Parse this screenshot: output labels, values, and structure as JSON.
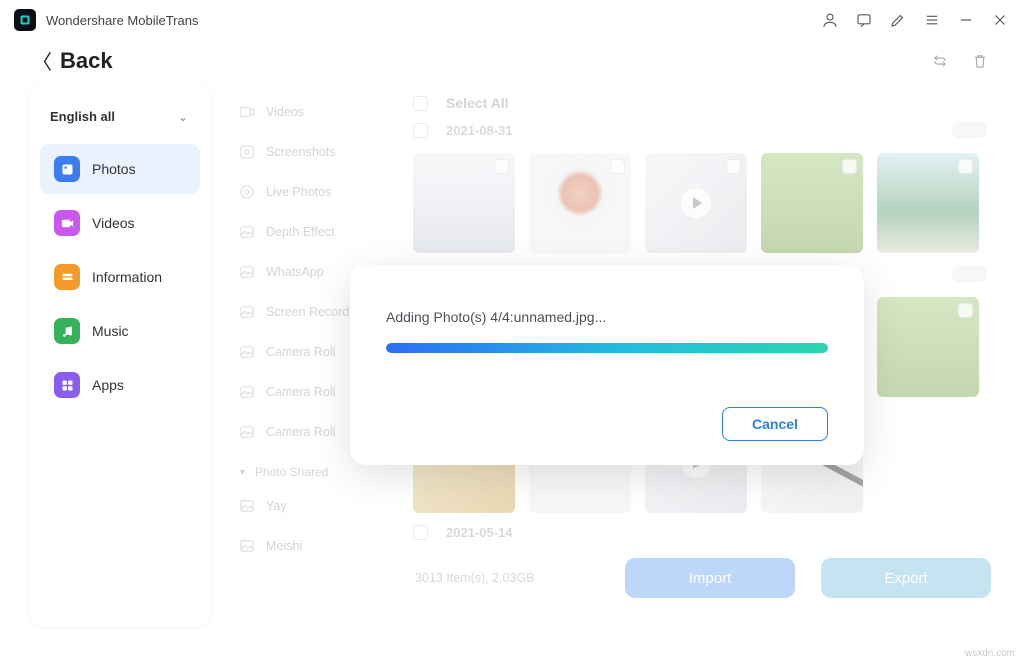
{
  "titlebar": {
    "title": "Wondershare MobileTrans"
  },
  "subbar": {
    "back": "Back"
  },
  "sidebar": {
    "lang": "English all",
    "items": [
      {
        "label": "Photos",
        "color": "#3b7df0",
        "active": true
      },
      {
        "label": "Videos",
        "color": "#c957f0",
        "active": false
      },
      {
        "label": "Information",
        "color": "#f29b2b",
        "active": false
      },
      {
        "label": "Music",
        "color": "#35b25a",
        "active": false
      },
      {
        "label": "Apps",
        "color": "#8a5df0",
        "active": false
      }
    ]
  },
  "categories": {
    "items": [
      "Videos",
      "Screenshots",
      "Live Photos",
      "Depth Effect",
      "WhatsApp",
      "Screen Recorder",
      "Camera Roll",
      "Camera Roll",
      "Camera Roll"
    ],
    "shared_header": "Photo Shared",
    "shared_items": [
      "Yay",
      "Meishi"
    ]
  },
  "content": {
    "select_all": "Select All",
    "group1_date": "2021-08-31",
    "group2_date": "2021-05-14",
    "stats": "3013 Item(s), 2.03GB",
    "import": "Import",
    "export": "Export"
  },
  "modal": {
    "text": "Adding Photo(s) 4/4:unnamed.jpg...",
    "cancel": "Cancel",
    "progress": 100
  },
  "watermark": "wsxdn.com"
}
